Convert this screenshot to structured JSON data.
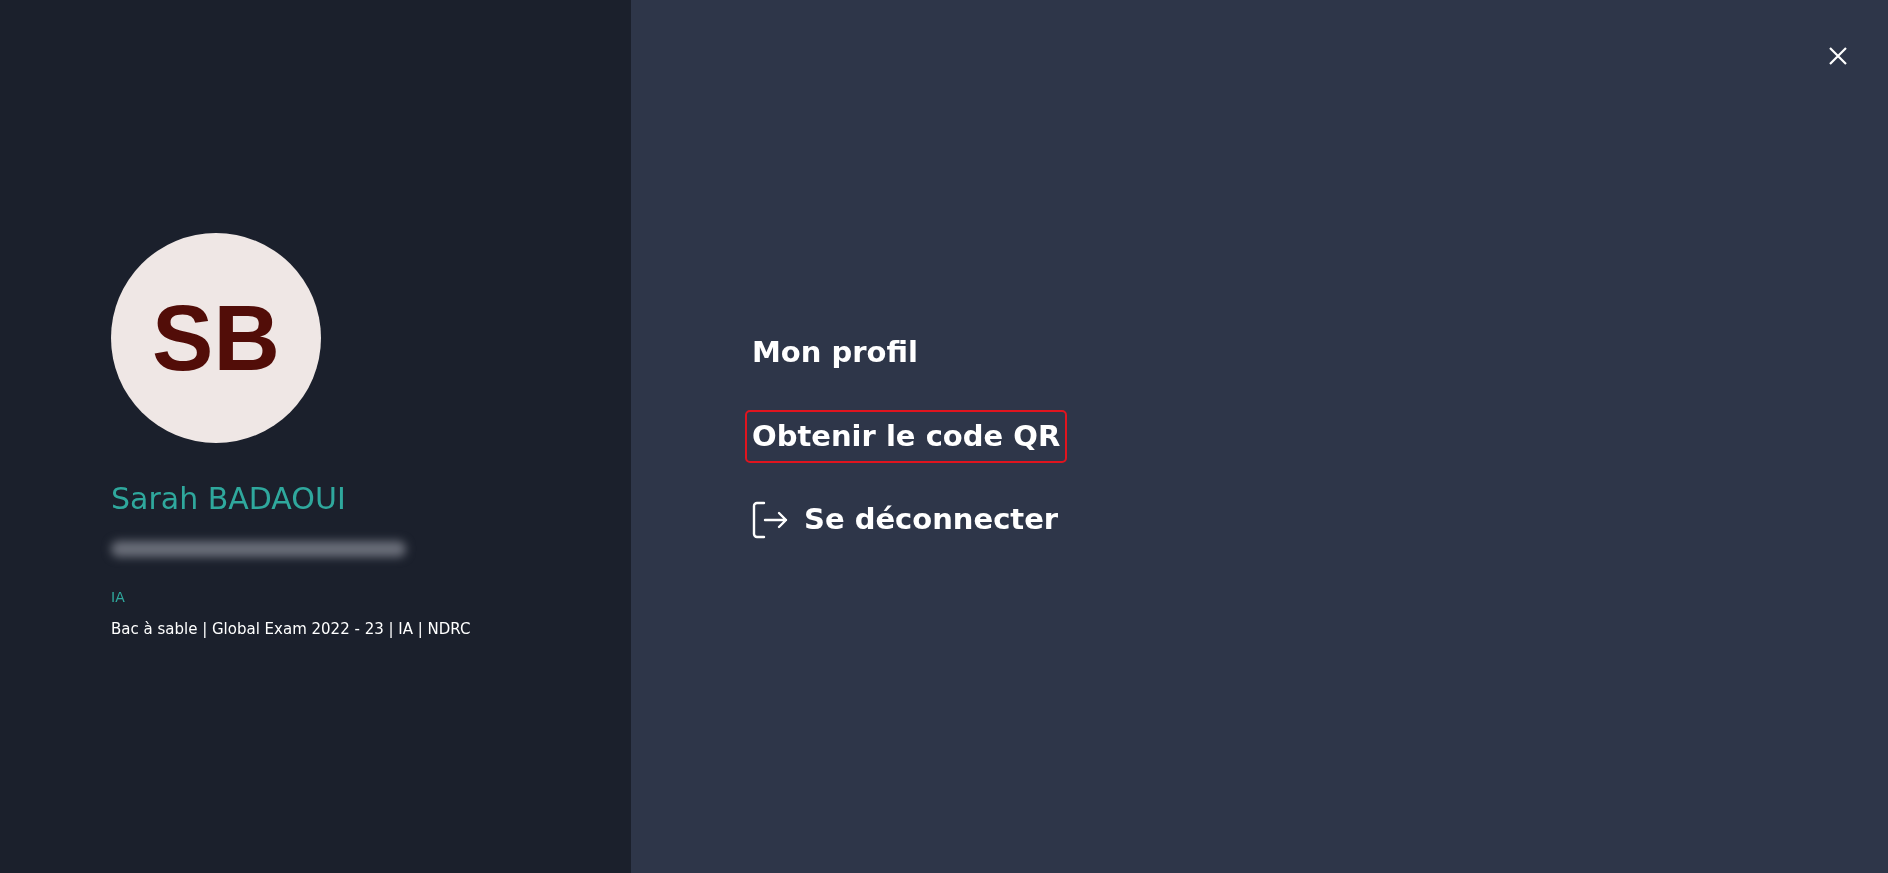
{
  "profile": {
    "initials": "SB",
    "name": "Sarah BADAOUI",
    "email_blurred": true,
    "role": "IA",
    "affiliation": "Bac à sable | Global Exam 2022 - 23 | IA | NDRC"
  },
  "menu": [
    {
      "kind": "link",
      "label": "Mon profil",
      "focused": false
    },
    {
      "kind": "link",
      "label": "Obtenir le code QR",
      "focused": true
    },
    {
      "kind": "logout",
      "label": "Se déconnecter",
      "focused": false
    }
  ],
  "close_button": true
}
